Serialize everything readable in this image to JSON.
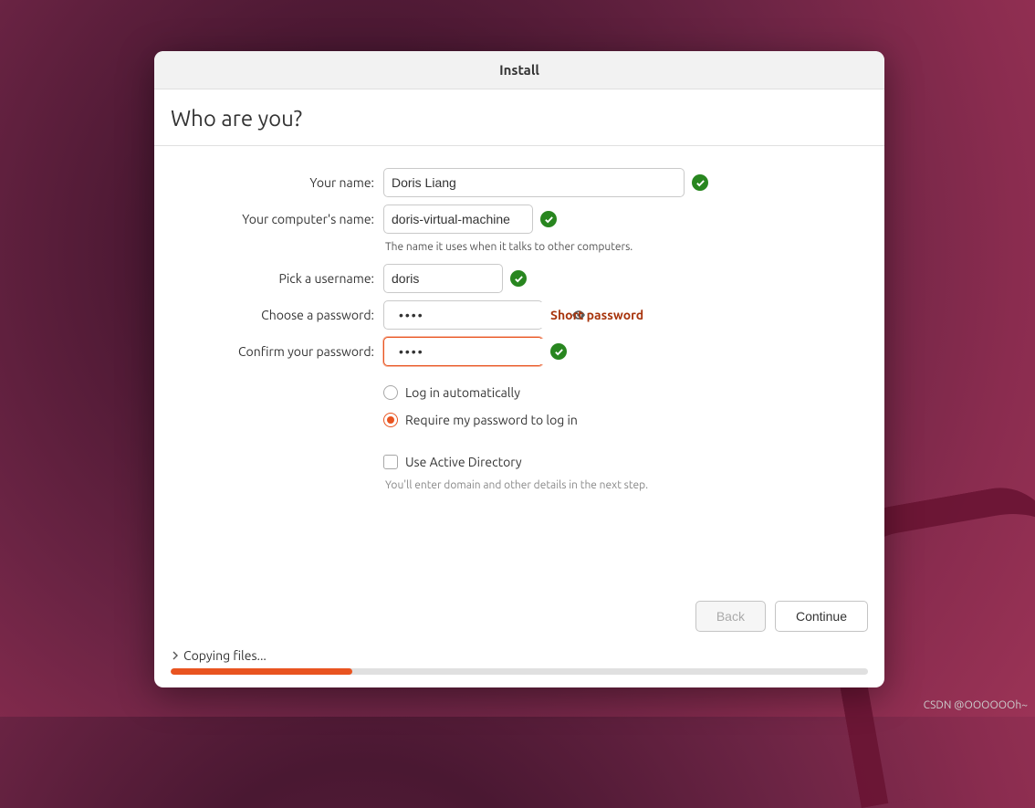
{
  "window": {
    "title": "Install"
  },
  "heading": "Who are you?",
  "labels": {
    "name": "Your name:",
    "computer": "Your computer's name:",
    "computer_hint": "The name it uses when it talks to other computers.",
    "username": "Pick a username:",
    "password": "Choose a password:",
    "confirm": "Confirm your password:"
  },
  "fields": {
    "name": "Doris Liang",
    "computer": "doris-virtual-machine",
    "username": "doris",
    "password": "••••",
    "confirm": "••••"
  },
  "password_feedback": "Short password",
  "options": {
    "auto_login": "Log in automatically",
    "require_pw": "Require my password to log in",
    "use_ad": "Use Active Directory",
    "ad_hint": "You'll enter domain and other details in the next step."
  },
  "buttons": {
    "back": "Back",
    "continue": "Continue"
  },
  "progress": {
    "label": "Copying files...",
    "percent": 26
  },
  "watermark": "CSDN @OOOOOOh~"
}
